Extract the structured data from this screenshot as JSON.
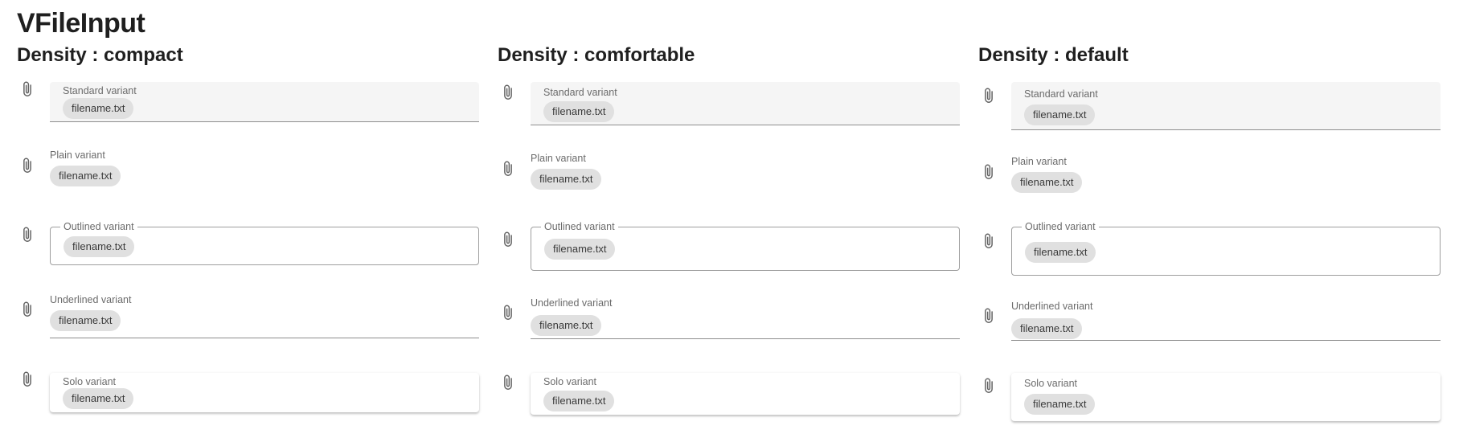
{
  "page": {
    "title": "VFileInput"
  },
  "icons": {
    "attach": "paperclip-icon"
  },
  "colors": {
    "standard_bg": "#f5f5f5",
    "chip_bg": "#e0e0e0",
    "label": "#6b6b6b"
  },
  "columns": [
    {
      "title": "Density : compact",
      "fields": [
        {
          "variant": "standard",
          "label": "Standard variant",
          "value": "filename.txt"
        },
        {
          "variant": "plain",
          "label": "Plain variant",
          "value": "filename.txt"
        },
        {
          "variant": "outlined",
          "label": "Outlined variant",
          "value": "filename.txt"
        },
        {
          "variant": "underlined",
          "label": "Underlined variant",
          "value": "filename.txt"
        },
        {
          "variant": "solo",
          "label": "Solo variant",
          "value": "filename.txt"
        }
      ]
    },
    {
      "title": "Density : comfortable",
      "fields": [
        {
          "variant": "standard",
          "label": "Standard variant",
          "value": "filename.txt"
        },
        {
          "variant": "plain",
          "label": "Plain variant",
          "value": "filename.txt"
        },
        {
          "variant": "outlined",
          "label": "Outlined variant",
          "value": "filename.txt"
        },
        {
          "variant": "underlined",
          "label": "Underlined variant",
          "value": "filename.txt"
        },
        {
          "variant": "solo",
          "label": "Solo variant",
          "value": "filename.txt"
        }
      ]
    },
    {
      "title": "Density : default",
      "fields": [
        {
          "variant": "standard",
          "label": "Standard variant",
          "value": "filename.txt"
        },
        {
          "variant": "plain",
          "label": "Plain variant",
          "value": "filename.txt"
        },
        {
          "variant": "outlined",
          "label": "Outlined variant",
          "value": "filename.txt"
        },
        {
          "variant": "underlined",
          "label": "Underlined variant",
          "value": "filename.txt"
        },
        {
          "variant": "solo",
          "label": "Solo variant",
          "value": "filename.txt"
        }
      ]
    }
  ]
}
